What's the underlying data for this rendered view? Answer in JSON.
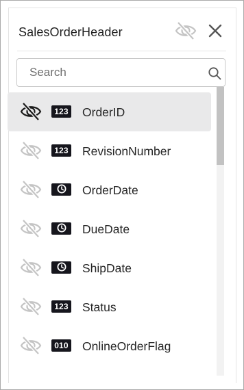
{
  "panel": {
    "title": "SalesOrderHeader",
    "hide_icon": "eye-slash-icon",
    "close_icon": "close-icon"
  },
  "search": {
    "placeholder": "Search",
    "value": "",
    "icon": "search-icon"
  },
  "fields": [
    {
      "name": "OrderID",
      "type_icon": "numeric-icon",
      "badge": "123",
      "visibility_icon": "eye-slash-icon",
      "selected": true
    },
    {
      "name": "RevisionNumber",
      "type_icon": "numeric-icon",
      "badge": "123",
      "visibility_icon": "eye-slash-icon",
      "selected": false
    },
    {
      "name": "OrderDate",
      "type_icon": "clock-icon",
      "badge": "",
      "visibility_icon": "eye-slash-icon",
      "selected": false
    },
    {
      "name": "DueDate",
      "type_icon": "clock-icon",
      "badge": "",
      "visibility_icon": "eye-slash-icon",
      "selected": false
    },
    {
      "name": "ShipDate",
      "type_icon": "clock-icon",
      "badge": "",
      "visibility_icon": "eye-slash-icon",
      "selected": false
    },
    {
      "name": "Status",
      "type_icon": "numeric-icon",
      "badge": "123",
      "visibility_icon": "eye-slash-icon",
      "selected": false
    },
    {
      "name": "OnlineOrderFlag",
      "type_icon": "boolean-icon",
      "badge": "010",
      "visibility_icon": "eye-slash-icon",
      "selected": false
    }
  ],
  "colors": {
    "badge_bg": "#16161d",
    "selected_row_bg": "#e9e9ea",
    "icon_muted": "#c4c4c4",
    "icon_active": "#1a1a1a"
  }
}
